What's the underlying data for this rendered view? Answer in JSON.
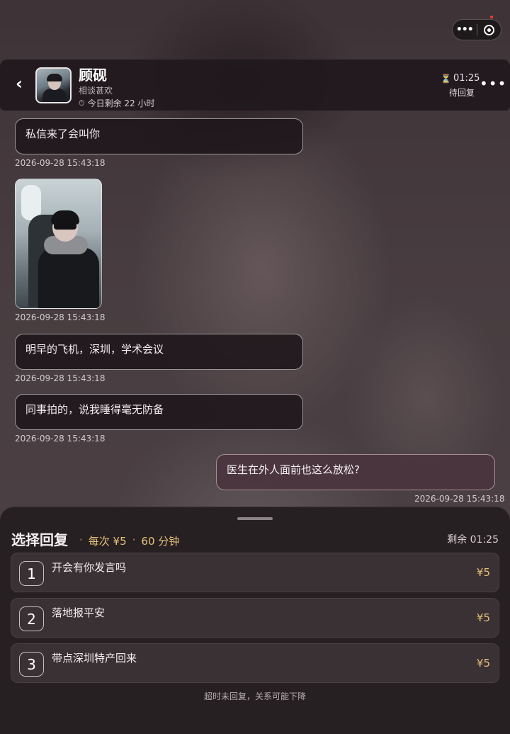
{
  "header": {
    "back_label": "‹",
    "name": "顾砚",
    "relation": "相谈甚欢",
    "remaining_label": "今日剩余 22 小时",
    "timer": "01:25",
    "status": "待回复",
    "more_label": "•••"
  },
  "capsule": {
    "more": "•••"
  },
  "messages": [
    {
      "type": "text",
      "from": "them",
      "text": "私信来了会叫你",
      "time": "2026-09-28 15:43:18"
    },
    {
      "type": "image",
      "from": "them",
      "time": "2026-09-28 15:43:18"
    },
    {
      "type": "text",
      "from": "them",
      "text": "明早的飞机，深圳，学术会议",
      "time": "2026-09-28 15:43:18"
    },
    {
      "type": "text",
      "from": "them",
      "text": "同事拍的，说我睡得毫无防备",
      "time": "2026-09-28 15:43:18"
    },
    {
      "type": "text",
      "from": "me",
      "text": "医生在外人面前也这么放松?",
      "time": "2026-09-28 15:43:18"
    }
  ],
  "reply_sheet": {
    "title": "选择回复",
    "dot": "·",
    "cost": "每次 ¥5",
    "duration": "60 分钟",
    "remaining": "剩余 01:25",
    "options": [
      {
        "num": "1",
        "text": "开会有你发言吗",
        "price": "¥5"
      },
      {
        "num": "2",
        "text": "落地报平安",
        "price": "¥5"
      },
      {
        "num": "3",
        "text": "带点深圳特产回来",
        "price": "¥5"
      }
    ],
    "footer": "超时未回复，关系可能下降"
  },
  "colors": {
    "accent_gold": "#e7c07a",
    "sheet_bg": "#262022"
  }
}
